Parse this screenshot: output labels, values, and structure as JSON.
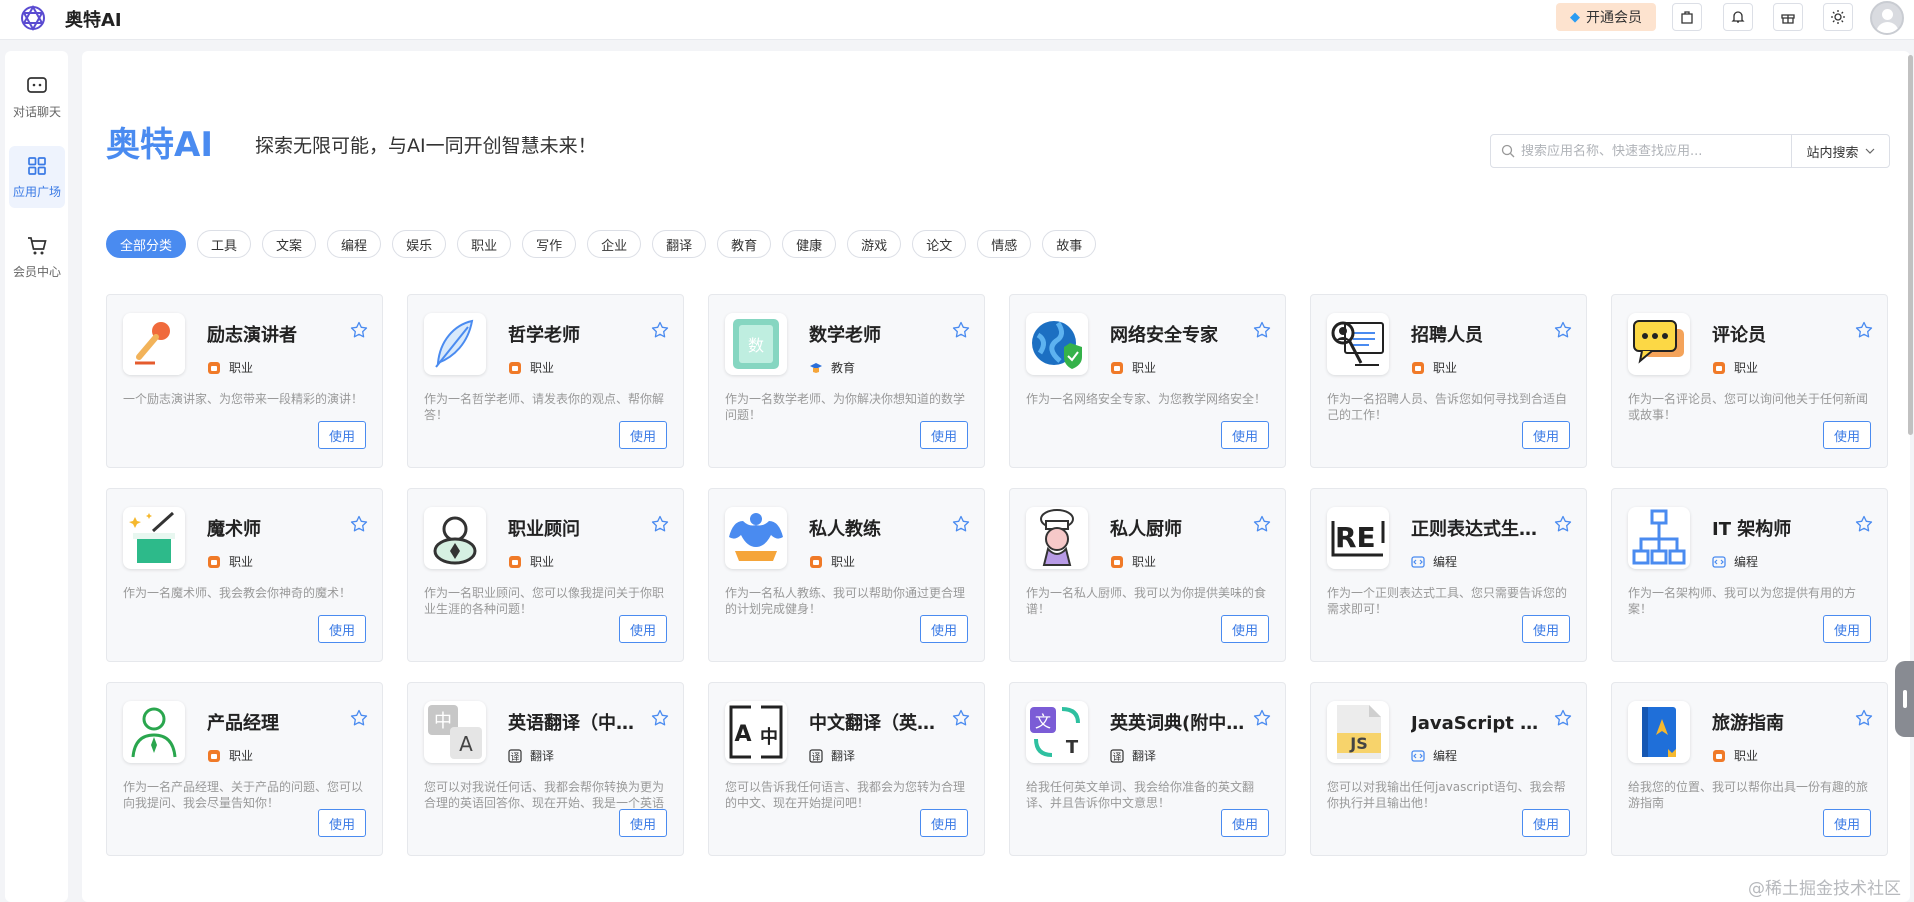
{
  "header": {
    "app_title": "奥特AI",
    "vip_label": "开通会员",
    "icons": [
      "bag-icon",
      "bell-icon",
      "gift-icon",
      "sun-icon"
    ]
  },
  "sidebar": {
    "items": [
      {
        "label": "对话聊天",
        "icon": "chat-icon",
        "active": false
      },
      {
        "label": "应用广场",
        "icon": "grid-icon",
        "active": true
      },
      {
        "label": "会员中心",
        "icon": "cart-icon",
        "active": false
      }
    ]
  },
  "main": {
    "brand": "奥特AI",
    "slogan": "探索无限可能，与AI一同开创智慧未来！",
    "search": {
      "placeholder": "搜索应用名称、快速查找应用...",
      "value": "",
      "scope": "站内搜索"
    },
    "filters": [
      "全部分类",
      "工具",
      "文案",
      "编程",
      "娱乐",
      "职业",
      "写作",
      "企业",
      "翻译",
      "教育",
      "健康",
      "游戏",
      "论文",
      "情感",
      "故事"
    ],
    "active_filter": "全部分类",
    "use_label": "使用",
    "cards": [
      {
        "title": "励志演讲者",
        "category": "职业",
        "desc": "一个励志演讲家、为您带来一段精彩的演讲！",
        "icon": "microphone-icon"
      },
      {
        "title": "哲学老师",
        "category": "职业",
        "desc": "作为一名哲学老师、请发表你的观点、帮你解答！",
        "icon": "feather-icon"
      },
      {
        "title": "数学老师",
        "category": "教育",
        "desc": "作为一名数学老师、为你解决你想知道的数学问题！",
        "icon": "math-book-icon"
      },
      {
        "title": "网络安全专家",
        "category": "职业",
        "desc": "作为一名网络安全专家、为您教学网络安全！",
        "icon": "globe-shield-icon"
      },
      {
        "title": "招聘人员",
        "category": "职业",
        "desc": "作为一名招聘人员、告诉您如何寻找到合适自己的工作！",
        "icon": "recruiter-icon"
      },
      {
        "title": "评论员",
        "category": "职业",
        "desc": "作为一名评论员、您可以询问他关于任何新闻或故事！",
        "icon": "speech-bubble-icon"
      },
      {
        "title": "魔术师",
        "category": "职业",
        "desc": "作为一名魔术师、我会教会你神奇的魔术！",
        "icon": "magic-hat-icon"
      },
      {
        "title": "职业顾问",
        "category": "职业",
        "desc": "作为一名职业顾问、您可以像我提问关于你职业生涯的各种问题！",
        "icon": "consultant-icon"
      },
      {
        "title": "私人教练",
        "category": "职业",
        "desc": "作为一名私人教练、我可以帮助你通过更合理的计划完成健身！",
        "icon": "muscle-icon"
      },
      {
        "title": "私人厨师",
        "category": "职业",
        "desc": "作为一名私人厨师、我可以为你提供美味的食谱！",
        "icon": "chef-icon"
      },
      {
        "title": "正则表达式生成器",
        "category": "编程",
        "desc": "作为一个正则表达式工具、您只需要告诉您的需求即可！",
        "icon": "regex-icon"
      },
      {
        "title": "IT 架构师",
        "category": "编程",
        "desc": "作为一名架构师、我可以为您提供有用的方案！",
        "icon": "hierarchy-icon"
      },
      {
        "title": "产品经理",
        "category": "职业",
        "desc": "作为一名产品经理、关于产品的问题、您可以向我提问、我会尽量告知你！",
        "icon": "person-icon"
      },
      {
        "title": "英语翻译（中英互译）",
        "category": "翻译",
        "desc": "您可以对我说任何话、我都会帮你转换为更为合理的英语回答你、现在开始、我是一个英语翻译！",
        "icon": "translate-zh-a-icon"
      },
      {
        "title": "中文翻译（英译中）",
        "category": "翻译",
        "desc": "您可以告诉我任何语言、我都会为您转为合理的中文、现在开始提问吧！",
        "icon": "translate-a-zh-icon"
      },
      {
        "title": "英英词典(附中文解释)",
        "category": "翻译",
        "desc": "给我任何英文单词、我会给你准备的英文翻译、并且告诉你中文意思！",
        "icon": "dictionary-icon"
      },
      {
        "title": "JavaScript 控制台",
        "category": "编程",
        "desc": "您可以对我输出任何javascript语句、我会帮你执行并且输出他！",
        "icon": "js-file-icon"
      },
      {
        "title": "旅游指南",
        "category": "职业",
        "desc": "给我您的位置、我可以帮你出具一份有趣的旅游指南",
        "icon": "guidebook-icon"
      }
    ]
  },
  "watermark": "@稀土掘金技术社区",
  "colors": {
    "accent": "#4a8bf0",
    "vip_bg": "#fde3cf",
    "card_bg": "#f7f8fa"
  }
}
